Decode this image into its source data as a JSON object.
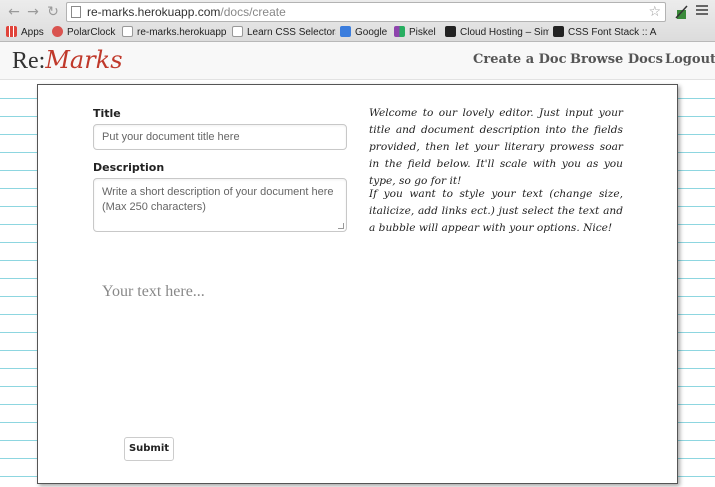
{
  "browser": {
    "url_host": "re-marks.herokuapp.com",
    "url_path": "/docs/create",
    "bookmarks": [
      {
        "label": "Apps",
        "icon": "apps-grid-icon",
        "color": "#e0433a"
      },
      {
        "label": "PolarClock",
        "icon": "polarclock-icon",
        "color": "#d9534f"
      },
      {
        "label": "re-marks.herokuapp...",
        "icon": "page-icon",
        "color": "#ffffff"
      },
      {
        "label": "Learn CSS Selectors",
        "icon": "page-icon",
        "color": "#ffffff"
      },
      {
        "label": "Google",
        "icon": "google-icon",
        "color": "#3b7ddd"
      },
      {
        "label": "Piskel",
        "icon": "piskel-icon",
        "color": "#8e44ad"
      },
      {
        "label": "Cloud Hosting – Sim",
        "icon": "cloud-icon",
        "color": "#222222"
      },
      {
        "label": "CSS Font Stack :: A c",
        "icon": "fontstack-icon",
        "color": "#222222"
      }
    ]
  },
  "site": {
    "logo_plain": "Re:",
    "logo_accent": "Marks",
    "nav": [
      "Create a Doc",
      "Browse Docs",
      "Logout"
    ]
  },
  "form": {
    "title_label": "Title",
    "title_placeholder": "Put your document title here",
    "description_label": "Description",
    "description_placeholder": "Write a short description of your document here (Max 250 characters)",
    "intro_1": "Welcome to our lovely editor. Just input your title and document description into the fields provided, then let your literary prowess soar in the field below. It'll scale with you as you type, so go for it!",
    "intro_2": "If you want to style your text (change size, italicize, add links ect.) just select the text and a bubble will appear with your options. Nice!",
    "editor_placeholder": "Your text here...",
    "submit_label": "Submit"
  },
  "colors": {
    "accent": "#c0392b",
    "paper_line": "#8dd6e0"
  }
}
